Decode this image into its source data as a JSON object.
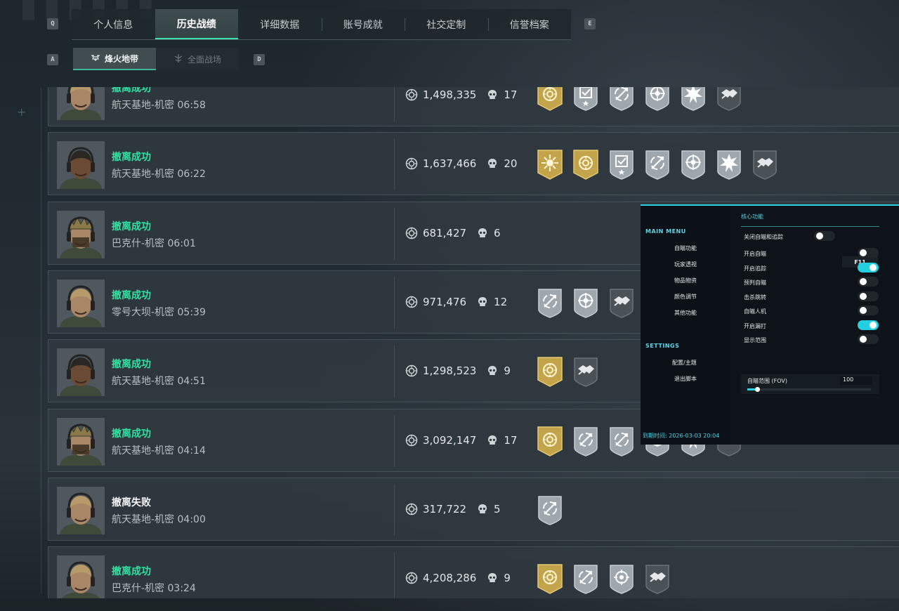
{
  "page": {
    "tabs": [
      {
        "label": "个人信息"
      },
      {
        "label": "历史战绩",
        "active": true
      },
      {
        "label": "详细数据"
      },
      {
        "label": "账号成就"
      },
      {
        "label": "社交定制"
      },
      {
        "label": "信誉档案"
      }
    ],
    "keys": {
      "prev_tab": "Q",
      "next_tab": "E",
      "prev_sub": "A",
      "next_sub": "D"
    },
    "subtabs": [
      {
        "label": "烽火地带",
        "active": true,
        "icon": "drone-icon"
      },
      {
        "label": "全面战场",
        "active": false,
        "icon": "airborne-icon"
      }
    ]
  },
  "colors": {
    "accent_green": "#2fe3a0",
    "accent_cyan": "#27d4e0",
    "gold_badge": "#c4a44a",
    "silver_badge": "#aeb6bb"
  },
  "matches": [
    {
      "status": "撤离成功",
      "success": true,
      "map": "航天基地-机密 06:58",
      "value": "1,498,335",
      "kills": "17",
      "avatar": "operator-1",
      "badges": [
        "gold-coin",
        "silver-tablet",
        "silver-sniper",
        "silver-target",
        "silver-burst",
        "dark-handshake"
      ]
    },
    {
      "status": "撤离成功",
      "success": true,
      "map": "航天基地-机密 06:22",
      "value": "1,637,466",
      "kills": "20",
      "avatar": "operator-2",
      "badges": [
        "gold-sun",
        "gold-coin",
        "silver-tablet",
        "silver-rotate",
        "silver-target",
        "silver-burst",
        "dark-handshake"
      ]
    },
    {
      "status": "撤离成功",
      "success": true,
      "map": "巴克什-机密 06:01",
      "value": "681,427",
      "kills": "6",
      "avatar": "operator-3",
      "badges": []
    },
    {
      "status": "撤离成功",
      "success": true,
      "map": "零号大坝-机密 05:39",
      "value": "971,476",
      "kills": "12",
      "avatar": "operator-1",
      "badges": [
        "silver-sniper",
        "silver-target",
        "dark-handshake"
      ]
    },
    {
      "status": "撤离成功",
      "success": true,
      "map": "航天基地-机密 04:51",
      "value": "1,298,523",
      "kills": "9",
      "avatar": "operator-2",
      "badges": [
        "gold-coin",
        "dark-handshake"
      ]
    },
    {
      "status": "撤离成功",
      "success": true,
      "map": "航天基地-机密 04:14",
      "value": "3,092,147",
      "kills": "17",
      "avatar": "operator-3",
      "badges": [
        "gold-coin",
        "silver-sniper",
        "silver-sniper",
        "silver-target",
        "silver-burst",
        "dark-handshake"
      ]
    },
    {
      "status": "撤离失败",
      "success": false,
      "map": "航天基地-机密 04:00",
      "value": "317,722",
      "kills": "5",
      "avatar": "operator-1",
      "badges": [
        "silver-sniper"
      ]
    },
    {
      "status": "撤离成功",
      "success": true,
      "map": "巴克什-机密 03:24",
      "value": "4,208,286",
      "kills": "9",
      "avatar": "operator-1",
      "badges": [
        "gold-coin",
        "silver-sniper",
        "silver-crosshair",
        "dark-handshake"
      ]
    }
  ],
  "overlay": {
    "main_menu_title": "MAIN MENU",
    "menu_items": [
      "自瞄功能",
      "玩家透视",
      "物品物资",
      "颜色调节",
      "其他功能"
    ],
    "settings_title": "SETTINGS",
    "settings_items": [
      "配置/主题",
      "退出脚本"
    ],
    "expiry": "到期时间: 2026-03-03 20:04",
    "panel_title": "核心功能",
    "options": [
      {
        "label": "关闭自瞄和追踪",
        "on": false,
        "hotkey": "F11"
      },
      {
        "label": "开启自瞄",
        "on": false
      },
      {
        "label": "开启追踪",
        "on": true
      },
      {
        "label": "预判自瞄",
        "on": false
      },
      {
        "label": "击杀跳转",
        "on": false
      },
      {
        "label": "自瞄人机",
        "on": false
      },
      {
        "label": "开启漏打",
        "on": true
      },
      {
        "label": "显示范围",
        "on": false
      }
    ],
    "fov": {
      "label": "自瞄范围 (FOV)",
      "value": "100",
      "fraction": 0.08
    }
  }
}
